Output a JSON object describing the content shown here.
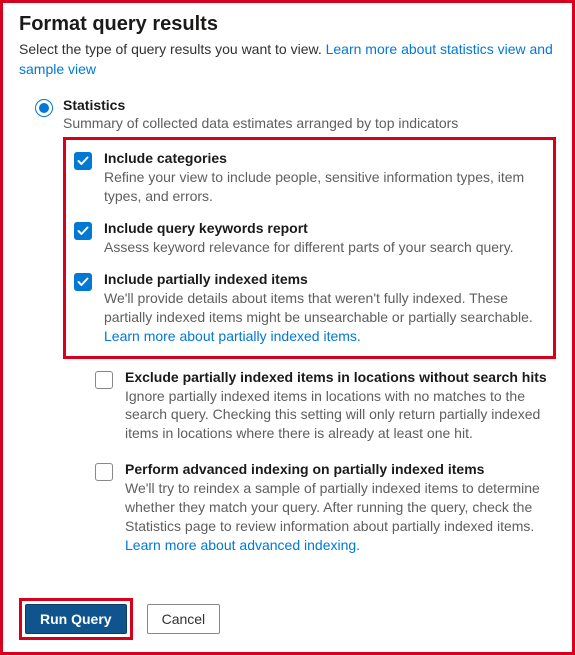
{
  "title": "Format query results",
  "subtitle_prefix": "Select the type of query results you want to view. ",
  "subtitle_link": "Learn more about statistics view and sample view",
  "radio": {
    "label": "Statistics",
    "desc": "Summary of collected data estimates arranged by top indicators"
  },
  "options": {
    "include_categories": {
      "label": "Include categories",
      "desc": "Refine your view to include people, sensitive information types, item types, and errors."
    },
    "include_keywords": {
      "label": "Include query keywords report",
      "desc": "Assess keyword relevance for different parts of your search query."
    },
    "include_partial": {
      "label": "Include partially indexed items",
      "desc": "We'll provide details about items that weren't fully indexed. These partially indexed items might be unsearchable or partially searchable. ",
      "link": "Learn more about partially indexed items."
    },
    "exclude_partial": {
      "label": "Exclude partially indexed items in locations without search hits",
      "desc": "Ignore partially indexed items in locations with no matches to the search query. Checking this setting will only return partially indexed items in locations where there is already at least one hit."
    },
    "advanced_index": {
      "label": "Perform advanced indexing on partially indexed items",
      "desc": "We'll try to reindex a sample of partially indexed items to determine whether they match your query. After running the query, check the Statistics page to review information about partially indexed items. ",
      "link": "Learn more about advanced indexing."
    }
  },
  "buttons": {
    "run": "Run Query",
    "cancel": "Cancel"
  }
}
